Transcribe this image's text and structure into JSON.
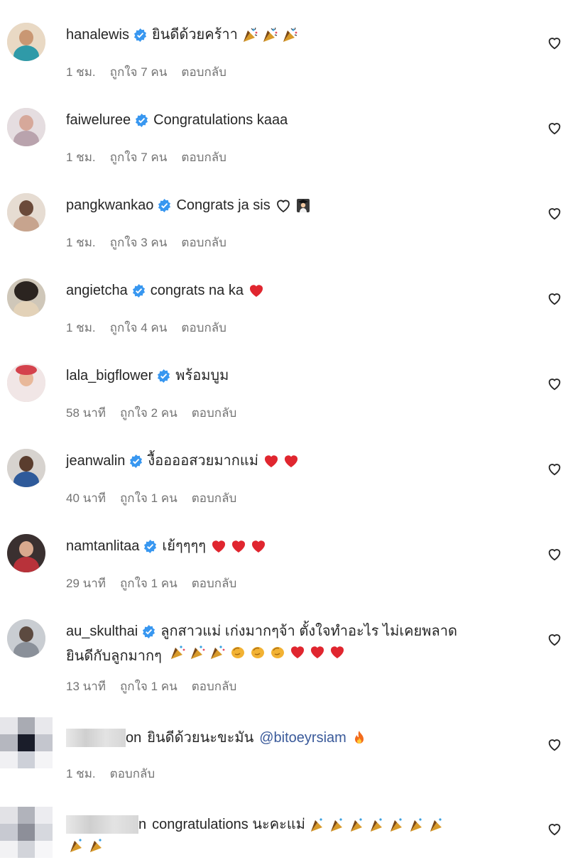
{
  "comments": [
    {
      "username": "hanalewis",
      "text": "ยินดีด้วยคร้าา",
      "emojis": [
        "party-popper",
        "party-popper",
        "party-popper"
      ],
      "time": "1 ชม.",
      "likes": "ถูกใจ 7 คน",
      "reply": "ตอบกลับ"
    },
    {
      "username": "faiweluree",
      "text": "Congratulations kaaa",
      "emojis": [],
      "time": "1 ชม.",
      "likes": "ถูกใจ 7 คน",
      "reply": "ตอบกลับ"
    },
    {
      "username": "pangkwankao",
      "text": "Congrats ja sis",
      "emojis": [
        "white-heart",
        "graduate"
      ],
      "time": "1 ชม.",
      "likes": "ถูกใจ 3 คน",
      "reply": "ตอบกลับ"
    },
    {
      "username": "angietcha",
      "text": "congrats na ka",
      "emojis": [
        "red-heart"
      ],
      "time": "1 ชม.",
      "likes": "ถูกใจ 4 คน",
      "reply": "ตอบกลับ"
    },
    {
      "username": "lala_bigflower",
      "text": "พร้อมบูม",
      "emojis": [],
      "time": "58 นาที",
      "likes": "ถูกใจ 2 คน",
      "reply": "ตอบกลับ"
    },
    {
      "username": "jeanwalin",
      "text": "งื้ออออสวยมากแม่",
      "emojis": [
        "red-heart",
        "red-heart"
      ],
      "time": "40 นาที",
      "likes": "ถูกใจ 1 คน",
      "reply": "ตอบกลับ"
    },
    {
      "username": "namtanlitaa",
      "text": "เย้ๆๆๆๆ",
      "emojis": [
        "red-heart",
        "red-heart",
        "red-heart"
      ],
      "time": "29 นาที",
      "likes": "ถูกใจ 1 คน",
      "reply": "ตอบกลับ"
    },
    {
      "username": "au_skulthai",
      "text": "ลูกสาวแม่ เก่งมากๆจ้า ตั้งใจทำอะไร ไม่เคยพลาด",
      "text2": "ยินดีกับลูกมากๆ",
      "emojis": [
        "party-popper",
        "party-popper",
        "party-popper",
        "clap",
        "clap",
        "clap",
        "red-heart",
        "red-heart",
        "red-heart"
      ],
      "time": "13 นาที",
      "likes": "ถูกใจ 1 คน",
      "reply": "ตอบกลับ"
    },
    {
      "username_suffix": "on",
      "text": "ยินดีด้วยนะขะมัน",
      "mention": "@bitoeyrsiam",
      "emojis": [
        "fire"
      ],
      "time": "1 ชม.",
      "reply": "ตอบกลับ"
    },
    {
      "username_suffix": "n",
      "text": "congratulations นะคะแม่",
      "emojis": [
        "party-popper",
        "party-popper",
        "party-popper",
        "party-popper",
        "party-popper",
        "party-popper",
        "party-popper",
        "party-popper",
        "party-popper"
      ]
    }
  ],
  "colors": {
    "verified": "#3897f0",
    "heart": "#e0262f",
    "meta": "#737373"
  }
}
